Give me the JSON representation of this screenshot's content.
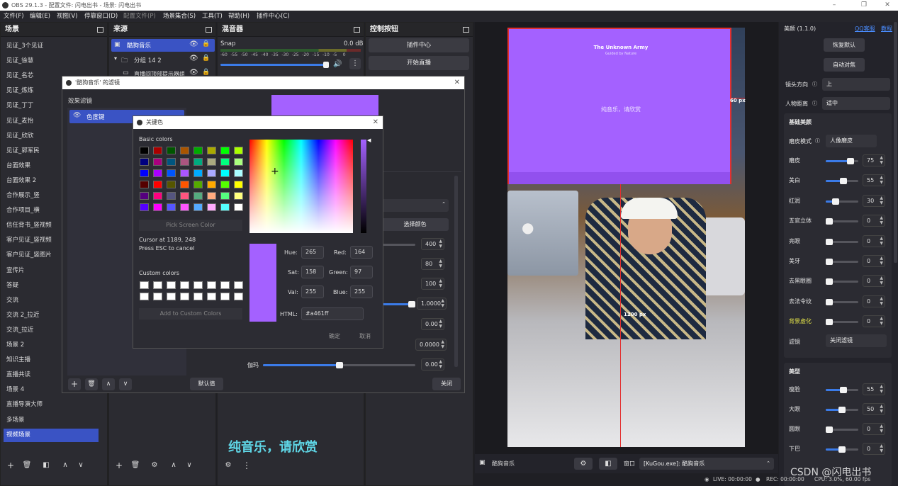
{
  "window": {
    "title": "OBS 29.1.3 - 配置文件: 闪电出书 - 场景: 闪电出书"
  },
  "menu": [
    "文件(F)",
    "编辑(E)",
    "视图(V)",
    "停靠窗口(D)",
    "配置文件(P)",
    "场景集合(S)",
    "工具(T)",
    "帮助(H)",
    "插件中心(C)"
  ],
  "docks": {
    "scenes": "场景",
    "sources": "来源",
    "mixer": "混音器",
    "controls": "控制按钮"
  },
  "scenes": [
    "见证_3个见证",
    "见证_徐慧",
    "见证_名芯",
    "见证_炼炼",
    "见证_丁丁",
    "见证_麦怡",
    "见证_欣欣",
    "见证_郭军民",
    "台面效果",
    "台面效果 2",
    "合作展示_竖",
    "合作项目_横",
    "信任背书_竖视频",
    "客户见证_竖视频",
    "客户见证_竖图片",
    "宣传片",
    "答疑",
    "交流",
    "交流 2_拉近",
    "交流_拉近",
    "场景 2",
    "知识主播",
    "直播共读",
    "场景 4",
    "直播导演大师",
    "多场景",
    "视频场景"
  ],
  "selected_scene": "视频场景",
  "sources": [
    {
      "name": "酷狗音乐",
      "selected": true
    },
    {
      "name": "分组 14 2",
      "selected": false
    },
    {
      "name": "直播间顶部提示器组件",
      "selected": false
    }
  ],
  "mixer": {
    "track": "Snap",
    "level": "0.0 dB",
    "scale": [
      "-60",
      "-55",
      "-50",
      "-45",
      "-40",
      "-35",
      "-30",
      "-25",
      "-20",
      "-15",
      "-10",
      "-5",
      "0"
    ]
  },
  "controls": [
    "插件中心",
    "开始直播"
  ],
  "filter_dialog": {
    "title": "'酷狗音乐' 的滤镜",
    "section": "效果滤镜",
    "filter": "色度键",
    "choose_color": "选择颜色",
    "defaults": "默认值",
    "close": "关闭",
    "values": [
      "400",
      "80",
      "100",
      "1.0000",
      "0.00",
      "0.0000",
      "0.00"
    ],
    "gamma_label": "伽玛",
    "gamma": "0.00"
  },
  "color_dialog": {
    "title": "关键色",
    "basic_colors": "Basic colors",
    "pick_screen": "Pick Screen Color",
    "cursor": "Cursor at 1189, 248",
    "esc": "Press ESC to cancel",
    "custom_colors": "Custom colors",
    "add_custom": "Add to Custom Colors",
    "hue_label": "Hue:",
    "hue": "265",
    "sat_label": "Sat:",
    "sat": "158",
    "val_label": "Val:",
    "val": "255",
    "red_label": "Red:",
    "red": "164",
    "green_label": "Green:",
    "green": "97",
    "blue_label": "Blue:",
    "blue": "255",
    "html_label": "HTML:",
    "html": "#a461ff",
    "ok": "确定",
    "cancel": "取消"
  },
  "basic_swatches": [
    "#000000",
    "#aa0000",
    "#005500",
    "#aa5500",
    "#00aa00",
    "#aaaa00",
    "#00ff00",
    "#aaff00",
    "#00007f",
    "#aa007f",
    "#00557f",
    "#aa557f",
    "#00aa7f",
    "#aaaa7f",
    "#00ff7f",
    "#aaff7f",
    "#0000ff",
    "#aa00ff",
    "#0055ff",
    "#aa55ff",
    "#00aaff",
    "#aaaaff",
    "#00ffff",
    "#aaffff",
    "#550000",
    "#ff0000",
    "#555500",
    "#ff5500",
    "#55aa00",
    "#ffaa00",
    "#55ff00",
    "#ffff00",
    "#55007f",
    "#ff007f",
    "#55557f",
    "#ff557f",
    "#55aa7f",
    "#ffaa7f",
    "#55ff7f",
    "#ffff7f",
    "#5500ff",
    "#ff00ff",
    "#5555ff",
    "#ff55ff",
    "#55aaff",
    "#ffaaff",
    "#55ffff",
    "#ffffff"
  ],
  "preview": {
    "player_title": "The Unknown Army",
    "player_sub": "Guided by Nature",
    "lyric": "纯音乐，请欣赏",
    "size_w": "60 px",
    "size_h": "1200 px",
    "accent": "#a461ff"
  },
  "subtitle": "纯音乐，请欣赏",
  "source_bar": {
    "name": "酷狗音乐",
    "window_label": "窗口",
    "window_value": "[KuGou.exe]: 酷狗音乐"
  },
  "beauty": {
    "title": "美颜 (1.1.0)",
    "qq": "QQ客服",
    "tutorial": "教程",
    "reset": "恢复默认",
    "auto_face": "自动对焦",
    "lens_label": "镜头方向",
    "lens_value": "上",
    "distance_label": "人物距离",
    "distance_value": "适中",
    "basic_title": "基础美颜",
    "skin_mode_label": "磨皮模式",
    "skin_mode": "人像磨皮",
    "items": [
      {
        "label": "磨皮",
        "value": "75",
        "pct": 0.75
      },
      {
        "label": "美白",
        "value": "55",
        "pct": 0.55
      },
      {
        "label": "红润",
        "value": "30",
        "pct": 0.3
      },
      {
        "label": "五官立体",
        "value": "0",
        "pct": 0
      },
      {
        "label": "亮眼",
        "value": "0",
        "pct": 0
      },
      {
        "label": "美牙",
        "value": "0",
        "pct": 0
      },
      {
        "label": "去黑眼圈",
        "value": "0",
        "pct": 0
      },
      {
        "label": "去法令纹",
        "value": "0",
        "pct": 0
      },
      {
        "label": "背景虚化",
        "value": "0",
        "pct": 0
      }
    ],
    "filter_label": "滤镜",
    "filter_value": "关闭滤镜",
    "shape_title": "美型",
    "shape_items": [
      {
        "label": "瘦脸",
        "value": "55",
        "pct": 0.55
      },
      {
        "label": "大眼",
        "value": "50",
        "pct": 0.5
      },
      {
        "label": "圆眼",
        "value": "0",
        "pct": 0
      },
      {
        "label": "下巴",
        "value": "0",
        "pct": 0.5
      }
    ]
  },
  "status": {
    "live": "LIVE: 00:00:00",
    "rec": "REC: 00:00:00",
    "cpu": "CPU: 3.0%, 60.00 fps"
  },
  "watermark": "CSDN @闪电出书"
}
